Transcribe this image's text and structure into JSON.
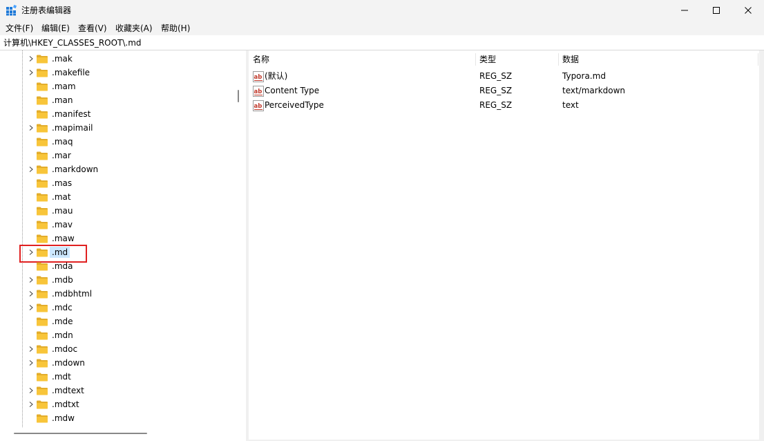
{
  "window": {
    "title": "注册表编辑器",
    "controls": [
      "minimize",
      "maximize",
      "close"
    ]
  },
  "menu": [
    "文件(F)",
    "编辑(E)",
    "查看(V)",
    "收藏夹(A)",
    "帮助(H)"
  ],
  "address": "计算机\\HKEY_CLASSES_ROOT\\.md",
  "tree": {
    "items": [
      {
        "label": ".mak",
        "expandable": true,
        "selected": false
      },
      {
        "label": ".makefile",
        "expandable": true,
        "selected": false
      },
      {
        "label": ".mam",
        "expandable": false,
        "selected": false
      },
      {
        "label": ".man",
        "expandable": false,
        "selected": false
      },
      {
        "label": ".manifest",
        "expandable": false,
        "selected": false
      },
      {
        "label": ".mapimail",
        "expandable": true,
        "selected": false
      },
      {
        "label": ".maq",
        "expandable": false,
        "selected": false
      },
      {
        "label": ".mar",
        "expandable": false,
        "selected": false
      },
      {
        "label": ".markdown",
        "expandable": true,
        "selected": false
      },
      {
        "label": ".mas",
        "expandable": false,
        "selected": false
      },
      {
        "label": ".mat",
        "expandable": false,
        "selected": false
      },
      {
        "label": ".mau",
        "expandable": false,
        "selected": false
      },
      {
        "label": ".mav",
        "expandable": false,
        "selected": false
      },
      {
        "label": ".maw",
        "expandable": false,
        "selected": false
      },
      {
        "label": ".md",
        "expandable": true,
        "selected": true
      },
      {
        "label": ".mda",
        "expandable": false,
        "selected": false
      },
      {
        "label": ".mdb",
        "expandable": true,
        "selected": false
      },
      {
        "label": ".mdbhtml",
        "expandable": true,
        "selected": false
      },
      {
        "label": ".mdc",
        "expandable": true,
        "selected": false
      },
      {
        "label": ".mde",
        "expandable": false,
        "selected": false
      },
      {
        "label": ".mdn",
        "expandable": false,
        "selected": false
      },
      {
        "label": ".mdoc",
        "expandable": true,
        "selected": false
      },
      {
        "label": ".mdown",
        "expandable": true,
        "selected": false
      },
      {
        "label": ".mdt",
        "expandable": false,
        "selected": false
      },
      {
        "label": ".mdtext",
        "expandable": true,
        "selected": false
      },
      {
        "label": ".mdtxt",
        "expandable": true,
        "selected": false
      },
      {
        "label": ".mdw",
        "expandable": false,
        "selected": false
      }
    ]
  },
  "list": {
    "columns": [
      "名称",
      "类型",
      "数据"
    ],
    "rows": [
      {
        "name": "(默认)",
        "type": "REG_SZ",
        "data": "Typora.md"
      },
      {
        "name": "Content Type",
        "type": "REG_SZ",
        "data": "text/markdown"
      },
      {
        "name": "PerceivedType",
        "type": "REG_SZ",
        "data": "text"
      }
    ]
  },
  "icons": {
    "app": "registry-editor-icon",
    "folder": "folder-icon",
    "expand": "chevron-right-icon",
    "value": "string-value-icon"
  },
  "colors": {
    "chrome": "#f3f3f3",
    "selection": "#cce8ff",
    "highlight_box": "#e02020",
    "folder": "#f8c53a",
    "value_icon": "#c0392b"
  }
}
